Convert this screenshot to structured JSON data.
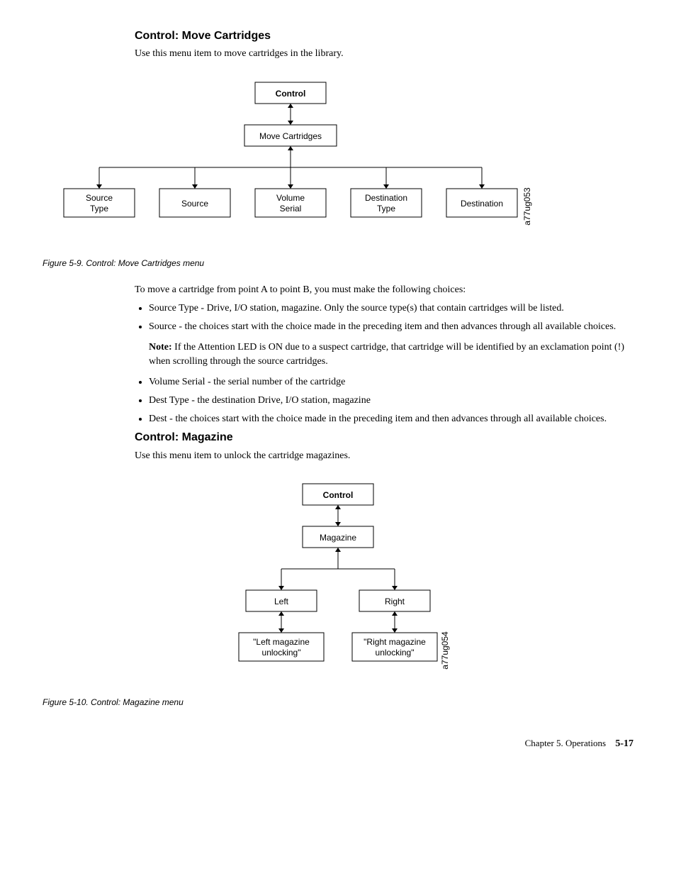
{
  "section1": {
    "title": "Control: Move Cartridges",
    "intro": "Use this menu item to move cartridges in the library.",
    "diagram": {
      "top": "Control",
      "middle": "Move Cartridges",
      "bottom": [
        "Source Type",
        "Source",
        "Volume Serial",
        "Destination Type",
        "Destination"
      ],
      "side_label": "a77ug053"
    },
    "caption": "Figure 5-9. Control: Move Cartridges menu",
    "lead": "To move a cartridge from point A to point B, you must make the following choices:",
    "bullets": [
      "Source Type - Drive, I/O station, magazine. Only the source type(s) that contain cartridges will be listed.",
      "Source - the choices start with the choice made in the preceding item and then advances through all available choices."
    ],
    "note": "If the Attention LED is ON due to a suspect cartridge, that cartridge will be identified by an exclamation point (!) when scrolling through the source cartridges.",
    "note_label": "Note:",
    "bullets2": [
      "Volume Serial - the serial number of the cartridge",
      "Dest Type - the destination Drive, I/O station, magazine",
      "Dest - the choices start with the choice made in the preceding item and then advances through all available choices."
    ]
  },
  "section2": {
    "title": "Control: Magazine",
    "intro": "Use this menu item to unlock the cartridge magazines.",
    "diagram": {
      "top": "Control",
      "middle": "Magazine",
      "left": "Left",
      "right": "Right",
      "left_msg": "\"Left magazine unlocking\"",
      "right_msg": "\"Right magazine unlocking\"",
      "side_label": "a77ug054"
    },
    "caption": "Figure 5-10. Control: Magazine menu"
  },
  "footer": {
    "chapter": "Chapter 5. Operations",
    "page": "5-17"
  }
}
